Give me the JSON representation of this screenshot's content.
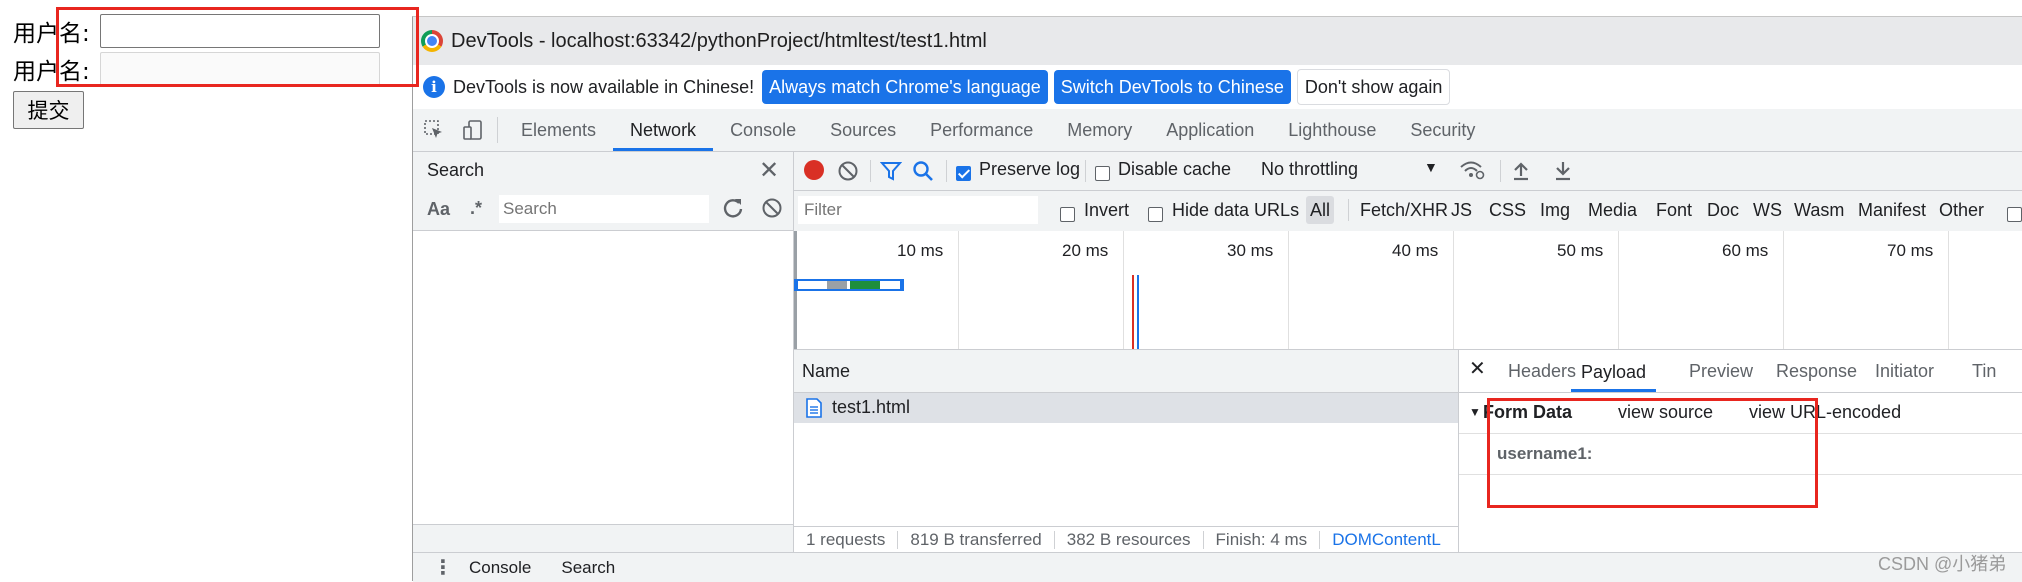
{
  "page_form": {
    "username_label": "用户名:",
    "password_label": "用户名:",
    "username_value": "",
    "password_value": "",
    "submit_label": "提交"
  },
  "devtools": {
    "title": "DevTools - localhost:63342/pythonProject/htmltest/test1.html",
    "infobar": {
      "icon": "info-icon",
      "message": "DevTools is now available in Chinese!",
      "btn_match": "Always match Chrome's language",
      "btn_switch": "Switch DevTools to Chinese",
      "btn_dismiss": "Don't show again"
    },
    "tabs": [
      "Elements",
      "Network",
      "Console",
      "Sources",
      "Performance",
      "Memory",
      "Application",
      "Lighthouse",
      "Security"
    ],
    "active_tab": "Network",
    "search_panel": {
      "title": "Search",
      "match_case": "Aa",
      "regex": ".*",
      "placeholder": "Search"
    },
    "network_toolbar": {
      "preserve_log": "Preserve log",
      "preserve_log_checked": true,
      "disable_cache": "Disable cache",
      "disable_cache_checked": false,
      "throttling": "No throttling"
    },
    "filter_bar": {
      "placeholder": "Filter",
      "invert": "Invert",
      "hide_data_urls": "Hide data URLs",
      "types": [
        "All",
        "Fetch/XHR",
        "JS",
        "CSS",
        "Img",
        "Media",
        "Font",
        "Doc",
        "WS",
        "Wasm",
        "Manifest",
        "Other"
      ],
      "active_type": "All"
    },
    "timeline_ticks": [
      "10 ms",
      "20 ms",
      "30 ms",
      "40 ms",
      "50 ms",
      "60 ms",
      "70 ms"
    ],
    "request_list": {
      "column_name": "Name",
      "rows": [
        {
          "name": "test1.html"
        }
      ]
    },
    "status_bar": {
      "requests": "1 requests",
      "transferred": "819 B transferred",
      "resources": "382 B resources",
      "finish": "Finish: 4 ms",
      "dom": "DOMContentL"
    },
    "details": {
      "tabs": [
        "Headers",
        "Payload",
        "Preview",
        "Response",
        "Initiator",
        "Tin"
      ],
      "active_tab": "Payload",
      "section_title": "Form Data",
      "view_source": "view source",
      "view_url": "view URL-encoded",
      "field_name": "username1:",
      "field_value": ""
    },
    "drawer": {
      "tabs": [
        "Console",
        "Search"
      ]
    }
  },
  "watermark": "CSDN @小猪弟",
  "colors": {
    "accent": "#1a73e8",
    "annotation_red": "#e8261f",
    "record_red": "#d93025"
  }
}
